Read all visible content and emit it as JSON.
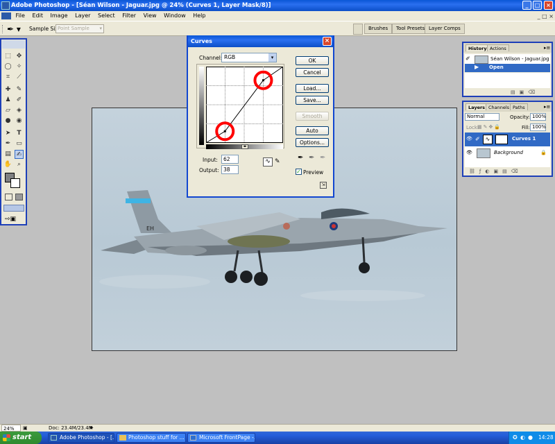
{
  "window": {
    "title": "Adobe Photoshop - [Séan Wilson - Jaguar.jpg @ 24% (Curves 1, Layer Mask/8)]",
    "min": "_",
    "max": "□",
    "close": "×"
  },
  "menu": {
    "items": [
      "File",
      "Edit",
      "Image",
      "Layer",
      "Select",
      "Filter",
      "View",
      "Window",
      "Help"
    ]
  },
  "options": {
    "sample_size_label": "Sample Size:",
    "sample_size_value": "Point Sample",
    "palette_well": [
      "Brushes",
      "Tool Presets",
      "Layer Comps"
    ]
  },
  "curves": {
    "title": "Curves",
    "channel_label": "Channel:",
    "channel_value": "RGB",
    "buttons": {
      "ok": "OK",
      "cancel": "Cancel",
      "load": "Load...",
      "save": "Save...",
      "smooth": "Smooth",
      "auto": "Auto",
      "options": "Options..."
    },
    "input_label": "Input:",
    "input_value": "62",
    "output_label": "Output:",
    "output_value": "38",
    "preview_label": "Preview",
    "preview_checked": true,
    "curve_points": [
      [
        0,
        0
      ],
      [
        62,
        38
      ],
      [
        190,
        210
      ],
      [
        255,
        255
      ]
    ],
    "annotation_color": "#ff0000"
  },
  "history": {
    "tabs": [
      "History",
      "Actions"
    ],
    "snapshot": "Séan Wilson - Jaguar.jpg",
    "state": "Open"
  },
  "layers": {
    "tabs": [
      "Layers",
      "Channels",
      "Paths"
    ],
    "blend_mode": "Normal",
    "opacity_label": "Opacity:",
    "opacity_value": "100%",
    "lock_label": "Lock:",
    "fill_label": "Fill:",
    "fill_value": "100%",
    "items": [
      {
        "name": "Curves 1",
        "selected": true
      },
      {
        "name": "Background",
        "selected": false
      }
    ]
  },
  "aircraft": {
    "tail_code": "EH"
  },
  "status": {
    "zoom": "24%",
    "doc": "Doc: 23.4M/23.4M"
  },
  "taskbar": {
    "start": "start",
    "tasks": [
      "Adobe Photoshop - [...",
      "Photoshop stuff for ...",
      "Microsoft FrontPage -..."
    ],
    "clock": "14:28"
  },
  "colors": {
    "xp_blue": "#0a57d6",
    "panel_bg": "#ece9d8",
    "selection": "#316ac5"
  }
}
